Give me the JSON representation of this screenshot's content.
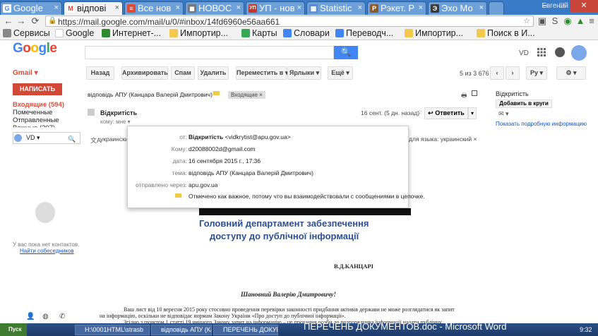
{
  "browser": {
    "tabs": [
      {
        "title": "Google",
        "fav": "G",
        "fav_color": "#4285f4",
        "active": false
      },
      {
        "title": "відпові",
        "fav": "M",
        "fav_color": "#d44638",
        "active": true
      },
      {
        "title": "Все нов",
        "fav": "≡",
        "fav_color": "#dd4b39",
        "active": false
      },
      {
        "title": "НОВОС",
        "fav": "◼",
        "fav_color": "#777",
        "active": false
      },
      {
        "title": "УП - нов",
        "fav": "УП",
        "fav_color": "#c0392b",
        "active": false
      },
      {
        "title": "Statistic",
        "fav": "▦",
        "fav_color": "#5a8ad1",
        "active": false
      },
      {
        "title": "Рэкет. Р",
        "fav": "Р",
        "fav_color": "#8a5a2b",
        "active": false
      },
      {
        "title": "Эхо Мо",
        "fav": "Э",
        "fav_color": "#3a3a3a",
        "active": false
      }
    ],
    "profile_name": "Евгений",
    "url": "https://mail.google.com/mail/u/0/#inbox/14fd6960e56aa661",
    "bookmarks": [
      "Сервисы",
      "Google",
      "Интернет-...",
      "Импортир...",
      "Карты",
      "Словари",
      "Переводч...",
      "Импортир...",
      "Поиск в И..."
    ]
  },
  "gmail": {
    "logo": "Google",
    "user_short": "VD",
    "label": "Gmail ▾",
    "toolbar": {
      "back": "Назад",
      "archive": "Архивировать",
      "spam": "Спам",
      "delete": "Удалить",
      "move": "Переместить в ▾",
      "labels": "Ярлыки ▾",
      "more": "Ещё ▾",
      "pager": "5 из 3 676",
      "lang": "Ру ▾",
      "settings": "⚙ ▾"
    },
    "sidebar": {
      "compose": "НАПИСАТЬ",
      "inbox": "Входящие (594)",
      "starred": "Помеченные",
      "sent": "Отправленные",
      "important": "Важные (207)",
      "chat_user": "VD ▾",
      "no_contacts": "У вас пока нет контактов.",
      "find_people": "Найти собеседников"
    },
    "message": {
      "subject": "відповідь АПУ (Канцара Валерій Дмитрович)",
      "label_tag": "Входящие  ×",
      "sender": "Відкритість",
      "to_me": "кому: мне ▾",
      "date": "16 сент. (5 дн. назад)",
      "reply": "↩ Ответить",
      "translate_partial": "украинский",
      "translate_right": "для языка: украинский  ×"
    },
    "right_panel": {
      "name": "Відкритість",
      "add_circles": "Добавить в круги",
      "more_info": "Показать подробную информацию"
    },
    "details": {
      "from_label": "от:",
      "from_name": "Відкритість",
      "from_email": "<vidkrytist@apu.gov.ua>",
      "to_label": "Кому:",
      "to_value": "d20088002d@gmail.com",
      "date_label": "дата:",
      "date_value": "16 сентября 2015 г., 17:36",
      "subject_label": "тема:",
      "subject_value": "відповідь АПУ (Канцара Валерій Дмитрович)",
      "via_label": "отправлено через:",
      "via_value": "apu.gov.ua",
      "important_note": "Отмечено как важное, потому что вы взаимодействовали с сообщениями в цепочке."
    },
    "letter": {
      "dept_line1": "Головний департамент забезпечення",
      "dept_line2": "доступу до публічної інформації",
      "addressee": "В.Д.КАНЦАРІ",
      "greeting": "Шановний Валерію Дмитровичу!",
      "para1a": "Ваш лист від 10 вересня 2015 року стосовно проведення перевірки законності придбання активів держави не може розглядатися як запит",
      "para1b": "на інформацію, оскільки не відповідає нормам Закону України «Про доступ до публічної інформації».",
      "para2": "Згідно з пунктом 1 статті 19 чинного Закону запит на інформацію – це прохання особи до розпорядника інформації надати публічну"
    }
  },
  "taskbar": {
    "start": "Пуск",
    "items": [
      "H:\\0001HTML\\strasb",
      "відповідь АПУ (Кан...",
      "ПЕРЕЧЕНЬ ДОКУМ..."
    ],
    "window_title": "ПЕРЕЧЕНЬ ДОКУМЕНТОВ.doc - Microsoft Word",
    "clock": "9:32"
  }
}
